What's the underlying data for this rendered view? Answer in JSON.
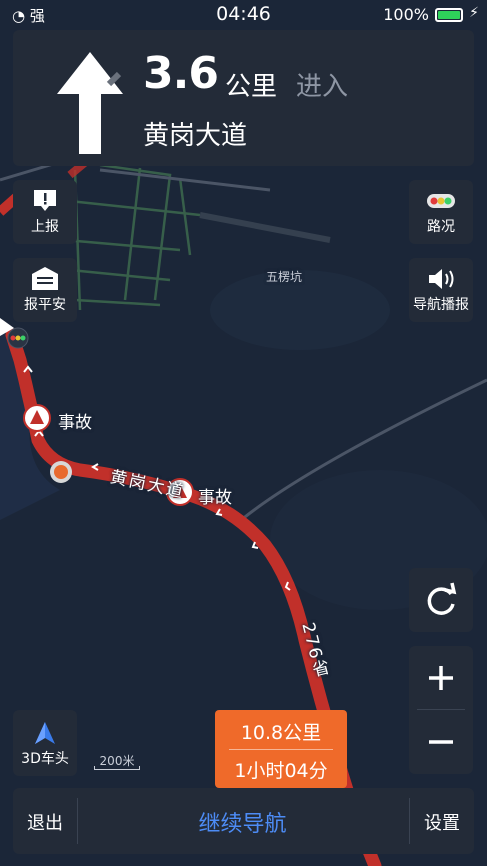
{
  "status_bar": {
    "carrier": "强",
    "time": "04:46",
    "battery": "100%"
  },
  "guidance": {
    "distance": "3.6",
    "distance_unit": "公里",
    "action": "进入",
    "road": "黄岗大道"
  },
  "left_buttons": {
    "report": "上报",
    "safe": "报平安"
  },
  "right_buttons": {
    "traffic": "路况",
    "voice": "导航播报"
  },
  "map": {
    "place": "五楞坑",
    "road_name": "黄岗大道",
    "route_shield": "276省",
    "incidents": [
      "事故",
      "事故"
    ],
    "scale": "200米"
  },
  "view_button": "3D车头",
  "eta": {
    "distance": "10.8公里",
    "time": "1小时04分"
  },
  "bottom_bar": {
    "exit": "退出",
    "continue": "继续导航",
    "settings": "设置"
  },
  "colors": {
    "background": "#1b2638",
    "panel": "#232b38",
    "route": "#c1302a",
    "accent": "#4d8cf6",
    "eta": "#ef6a2a"
  }
}
